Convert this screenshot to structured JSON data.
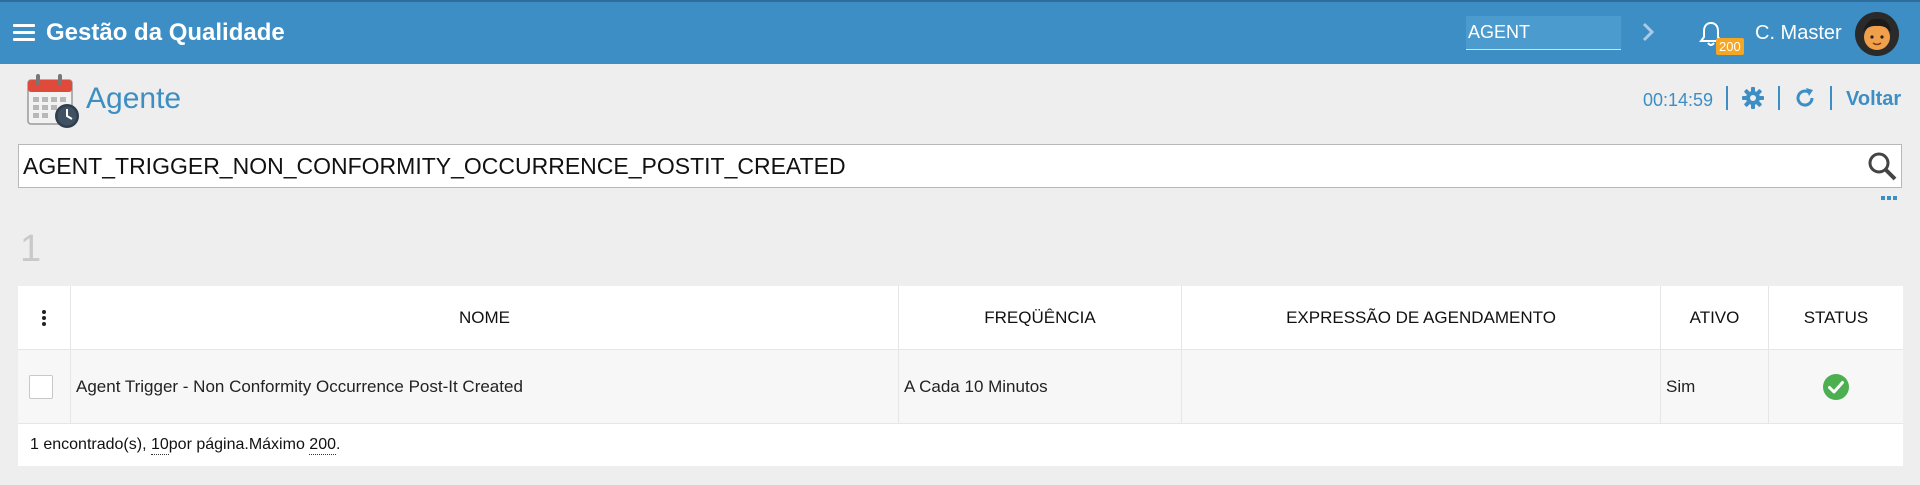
{
  "topbar": {
    "app_title": "Gestão da Qualidade",
    "agent_input_value": "AGENT",
    "notification_count": "200",
    "user_name": "C. Master",
    "bg_color": "#3d8ec4"
  },
  "header": {
    "title": "Agente",
    "timer": "00:14:59",
    "back_label": "Voltar"
  },
  "search": {
    "value": "AGENT_TRIGGER_NON_CONFORMITY_OCCURRENCE_POSTIT_CREATED"
  },
  "result_count": "1",
  "table": {
    "columns": [
      "NOME",
      "FREQÜÊNCIA",
      "EXPRESSÃO DE AGENDAMENTO",
      "ATIVO",
      "STATUS"
    ],
    "rows": [
      {
        "nome": "Agent Trigger - Non Conformity Occurrence Post-It Created",
        "frequencia": "A Cada 10 Minutos",
        "expressao": "",
        "ativo": "Sim",
        "status": "success-check-icon"
      }
    ],
    "footer": {
      "found": "1 encontrado(s), ",
      "per_page": "10",
      "per_page_suffix": " por página.",
      "max_label": "Máximo ",
      "max_value": "200",
      "end": "."
    }
  },
  "icons": [
    "menu-icon",
    "chevron-right-icon",
    "bell-icon",
    "avatar",
    "calendar-clock-icon",
    "gear-icon",
    "refresh-icon",
    "search-icon",
    "more-dots-icon",
    "column-options-icon",
    "success-check-icon"
  ],
  "colors": {
    "accent": "#3d8ec4",
    "success": "#4caf50",
    "badge": "#f5a623"
  }
}
